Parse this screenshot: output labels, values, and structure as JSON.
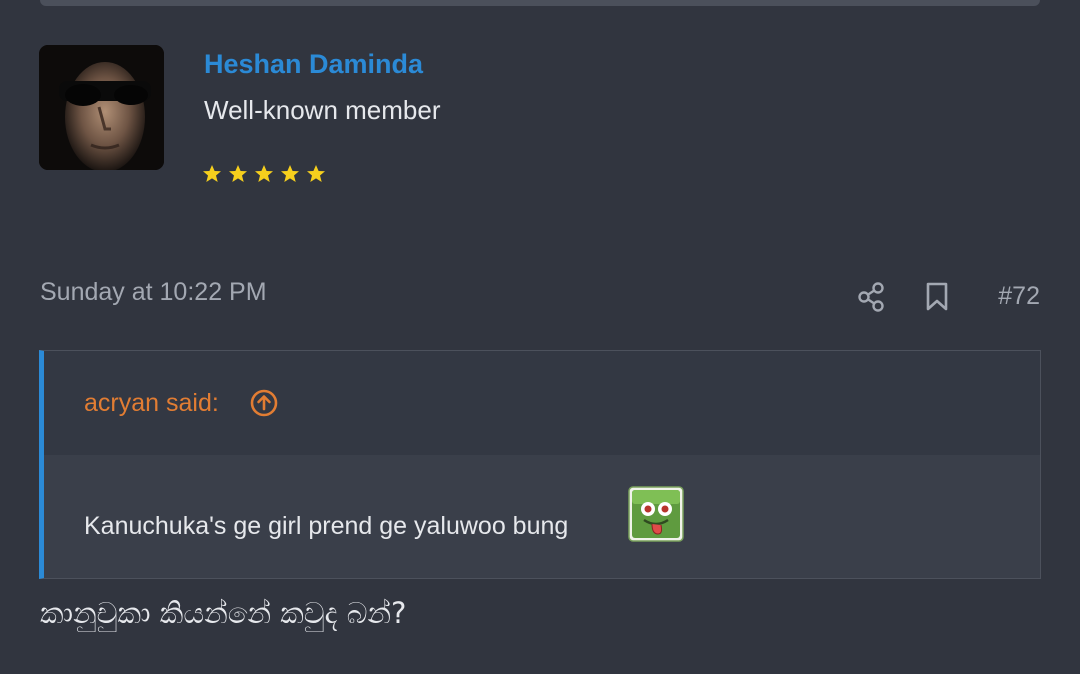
{
  "user": {
    "name": "Heshan Daminda",
    "title": "Well-known member",
    "stars": 5,
    "star_color": "#f6cf1d"
  },
  "post": {
    "date": "Sunday at 10:22 PM",
    "number": "#72",
    "body": "කානුචුකා කියන්නේ කවුද බන්?"
  },
  "quote": {
    "author": "acryan said:",
    "text": "Kanuchuka's ge girl prend ge yaluwoo bung",
    "smiley": "tongue-out-smiley"
  },
  "icons": {
    "share": "share-icon",
    "bookmark": "bookmark-icon",
    "jump": "arrow-up-circle-icon"
  },
  "colors": {
    "background": "#31353f",
    "username": "#2b8ad6",
    "quote_border": "#2b8ad6",
    "quote_author": "#e27d33",
    "muted_text": "#a3a8b2"
  }
}
